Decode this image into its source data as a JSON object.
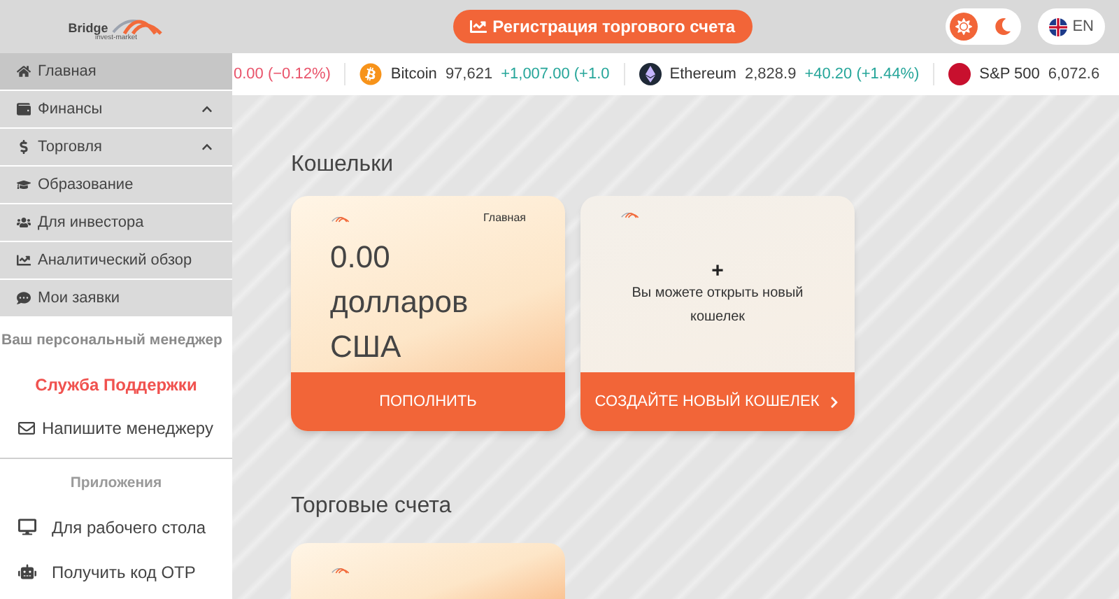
{
  "header": {
    "logo": {
      "name": "Bridge",
      "tagline": "invest-market"
    },
    "register_button": "Регистрация торгового счета",
    "theme": [
      {
        "kind": "light",
        "selected": true
      },
      {
        "kind": "dark",
        "selected": false
      }
    ],
    "language": "EN"
  },
  "sidebar": {
    "items": [
      {
        "label": "Главная",
        "kind": "link",
        "selected": true
      },
      {
        "label": "Финансы",
        "kind": "group",
        "selected": false
      },
      {
        "label": "Торговля",
        "kind": "group",
        "selected": false
      },
      {
        "label": "Образование",
        "kind": "link",
        "selected": false
      },
      {
        "label": "Для инвестора",
        "kind": "link",
        "selected": false
      },
      {
        "label": "Аналитический обзор",
        "kind": "link",
        "selected": false
      },
      {
        "label": "Мои заявки",
        "kind": "link",
        "selected": false
      }
    ],
    "manager_title": "Ваш персональный менеджер",
    "support": "Служба Поддержки",
    "write_manager": "Напишите менеджеру",
    "apps_title": "Приложения",
    "apps": [
      {
        "label": "Для рабочего стола"
      },
      {
        "label": "Получить код OTP"
      }
    ]
  },
  "ticker": [
    {
      "change": "0.00 (−0.12%)",
      "kind": "down"
    },
    {
      "name": "Bitcoin",
      "price": "97,621",
      "change": "+1,007.00 (+1.0",
      "kind": "up"
    },
    {
      "name": "Ethereum",
      "price": "2,828.9",
      "change": "+40.20 (+1.44%)",
      "kind": "up"
    },
    {
      "name": "S&P 500",
      "price": "6,072.6"
    }
  ],
  "wallets": {
    "title": "Кошельки",
    "cards": [
      {
        "kind": "wallet",
        "tag": "Главная",
        "amount": "0.00 долларов США",
        "action": "ПОПОЛНИТЬ"
      },
      {
        "kind": "new",
        "plus": "+",
        "text": "Вы можете открыть новый кошелек",
        "action": "СОЗДАЙТЕ НОВЫЙ КОШЕЛЕК"
      }
    ]
  },
  "trading": {
    "title": "Торговые счета"
  }
}
